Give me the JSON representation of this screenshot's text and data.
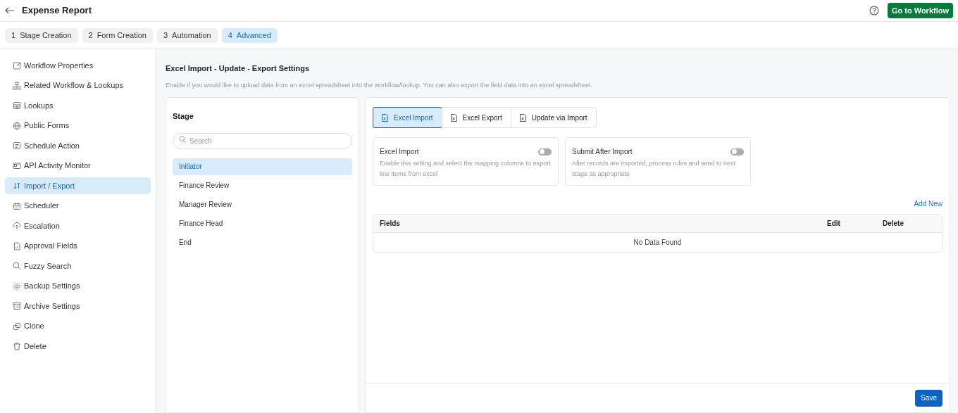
{
  "header": {
    "title": "Expense Report",
    "action": "Go to Workflow"
  },
  "steps": [
    {
      "number": "1",
      "label": "Stage Creation",
      "selected": false
    },
    {
      "number": "2",
      "label": "Form Creation",
      "selected": false
    },
    {
      "number": "3",
      "label": "Automation",
      "selected": false
    },
    {
      "number": "4",
      "label": "Advanced",
      "selected": true
    }
  ],
  "sidebar": {
    "items": [
      {
        "label": "Workflow Properties",
        "selected": false
      },
      {
        "label": "Related Workflow & Lookups",
        "selected": false
      },
      {
        "label": "Lookups",
        "selected": false
      },
      {
        "label": "Public Forms",
        "selected": false
      },
      {
        "label": "Schedule Action",
        "selected": false
      },
      {
        "label": "API Activity Monitor",
        "selected": false
      },
      {
        "label": "Import / Export",
        "selected": true
      },
      {
        "label": "Scheduler",
        "selected": false
      },
      {
        "label": "Escalation",
        "selected": false
      },
      {
        "label": "Approval Fields",
        "selected": false
      },
      {
        "label": "Fuzzy Search",
        "selected": false
      },
      {
        "label": "Backup Settings",
        "selected": false
      },
      {
        "label": "Archive Settings",
        "selected": false
      },
      {
        "label": "Clone",
        "selected": false
      },
      {
        "label": "Delete",
        "selected": false
      }
    ]
  },
  "section": {
    "title": "Excel Import - Update - Export Settings",
    "description": "Enable if you would like to upload data from an excel spreadsheet into the workflow/lookup. You can also export the field data into an excel spreadsheet."
  },
  "stage_panel": {
    "title": "Stage",
    "search": {
      "placeholder": "Search"
    },
    "stages": [
      {
        "label": "Initiator",
        "selected": true
      },
      {
        "label": "Finance Review",
        "selected": false
      },
      {
        "label": "Manager Review",
        "selected": false
      },
      {
        "label": "Finance Head",
        "selected": false
      },
      {
        "label": "End",
        "selected": false
      }
    ]
  },
  "tabs": [
    {
      "label": "Excel Import",
      "selected": true
    },
    {
      "label": "Excel Export",
      "selected": false
    },
    {
      "label": "Update via Import",
      "selected": false
    }
  ],
  "settings": [
    {
      "title": "Excel Import",
      "description": "Enable this setting and select the mapping columns to export line items from excel",
      "on": false
    },
    {
      "title": "Submit After Import",
      "description": "After records are imported, process rules and send to next stage as appropriate",
      "on": false
    }
  ],
  "add_new": "Add New",
  "table": {
    "columns": [
      "Fields",
      "Edit",
      "Delete"
    ],
    "empty": "No Data Found"
  },
  "save": "Save"
}
